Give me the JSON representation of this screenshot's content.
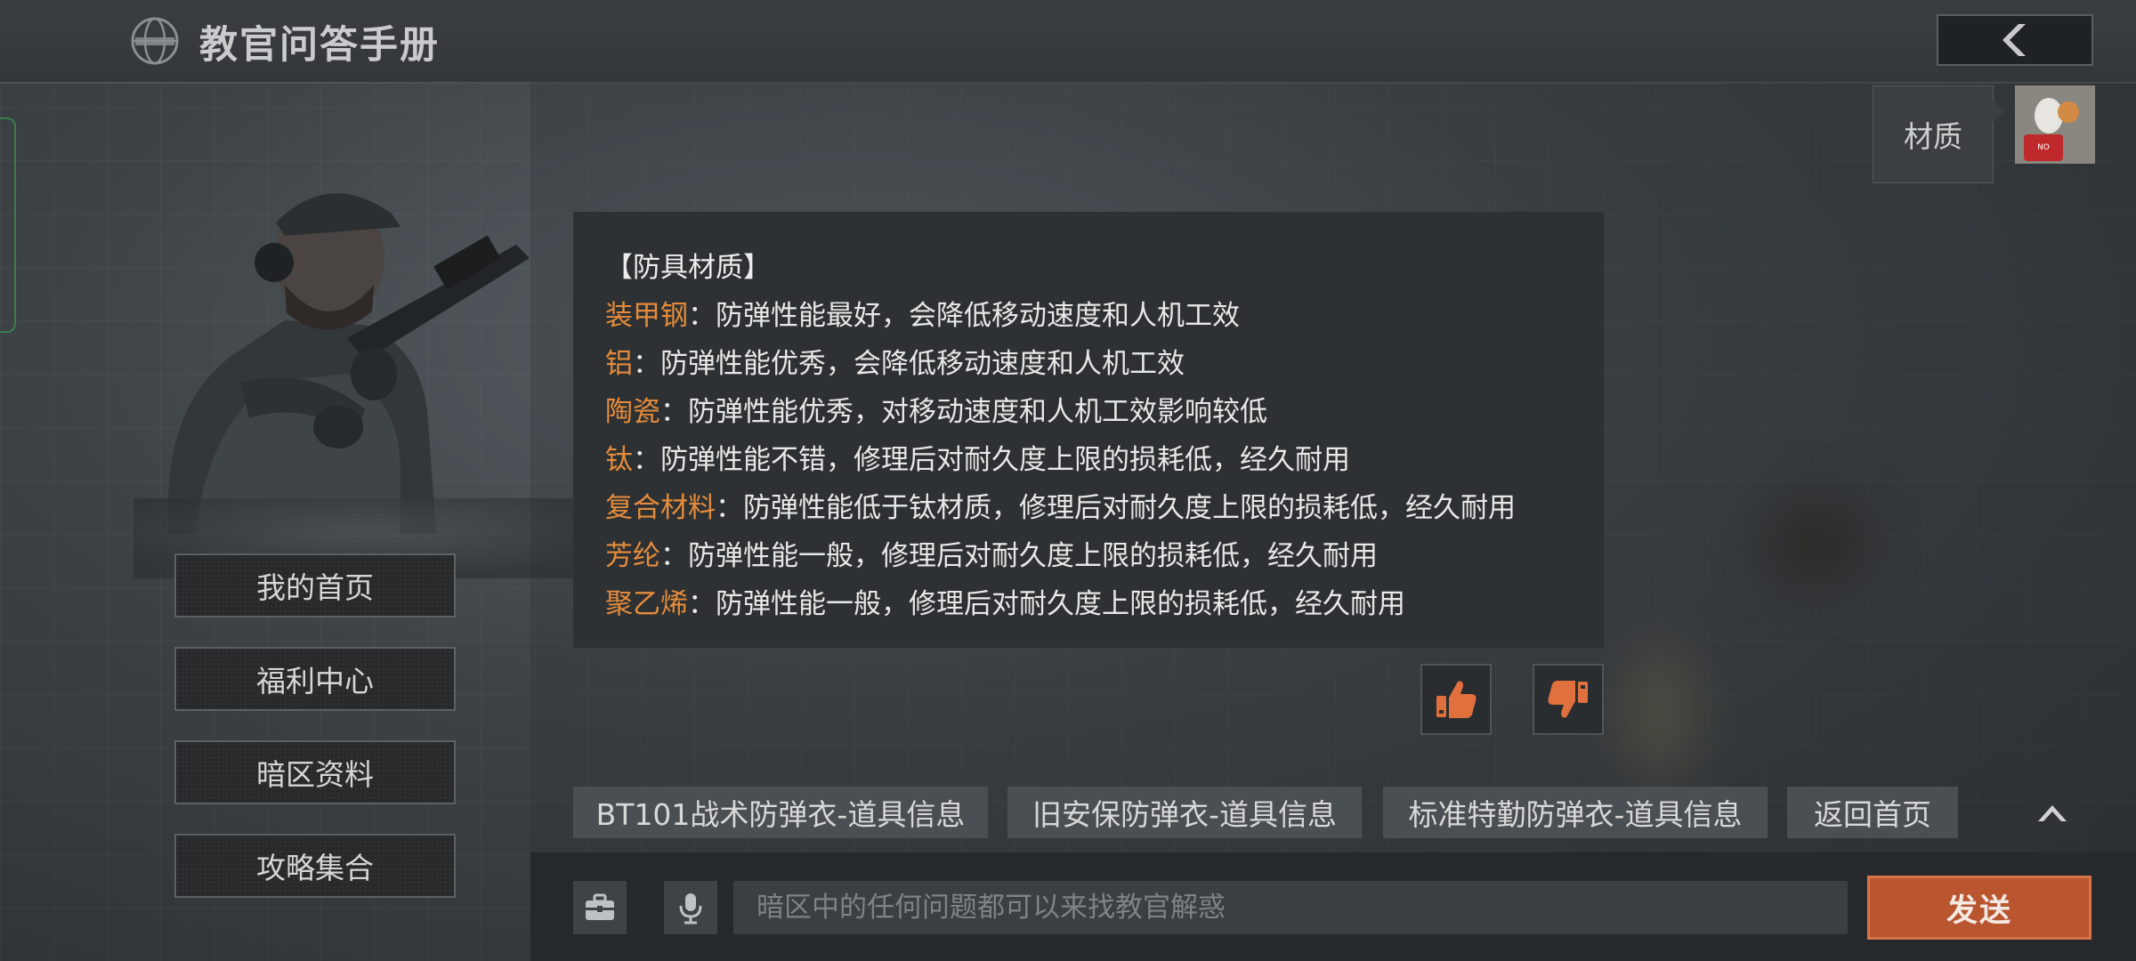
{
  "header": {
    "title": "教官问答手册",
    "logo_icon": "globe-helmet-icon",
    "back_icon": "chevron-left-icon"
  },
  "sidebar": {
    "items": [
      {
        "label": "我的首页"
      },
      {
        "label": "福利中心"
      },
      {
        "label": "暗区资料"
      },
      {
        "label": "攻略集合"
      }
    ]
  },
  "chat": {
    "query_tag": "材质",
    "answer": {
      "heading": "【防具材质】",
      "separator": "：",
      "rows": [
        {
          "term": "装甲钢",
          "desc": "防弹性能最好，会降低移动速度和人机工效"
        },
        {
          "term": "铝",
          "desc": "防弹性能优秀，会降低移动速度和人机工效"
        },
        {
          "term": "陶瓷",
          "desc": "防弹性能优秀，对移动速度和人机工效影响较低"
        },
        {
          "term": "钛",
          "desc": "防弹性能不错，修理后对耐久度上限的损耗低，经久耐用"
        },
        {
          "term": "复合材料",
          "desc": "防弹性能低于钛材质，修理后对耐久度上限的损耗低，经久耐用"
        },
        {
          "term": "芳纶",
          "desc": "防弹性能一般，修理后对耐久度上限的损耗低，经久耐用"
        },
        {
          "term": "聚乙烯",
          "desc": "防弹性能一般，修理后对耐久度上限的损耗低，经久耐用"
        }
      ]
    },
    "feedback": {
      "like_icon": "thumbs-up-icon",
      "dislike_icon": "thumbs-down-icon"
    }
  },
  "suggestions": [
    {
      "label": "BT101战术防弹衣-道具信息"
    },
    {
      "label": "旧安保防弹衣-道具信息"
    },
    {
      "label": "标准特勤防弹衣-道具信息"
    },
    {
      "label": "返回首页"
    }
  ],
  "input": {
    "placeholder": "暗区中的任何问题都可以来找教官解惑",
    "value": "",
    "send_label": "发送",
    "toolbox_icon": "toolbox-icon",
    "mic_icon": "microphone-icon"
  },
  "colors": {
    "accent_orange": "#e58c3c",
    "send_button": "#b9552f",
    "feedback_icon": "#e0703e"
  }
}
